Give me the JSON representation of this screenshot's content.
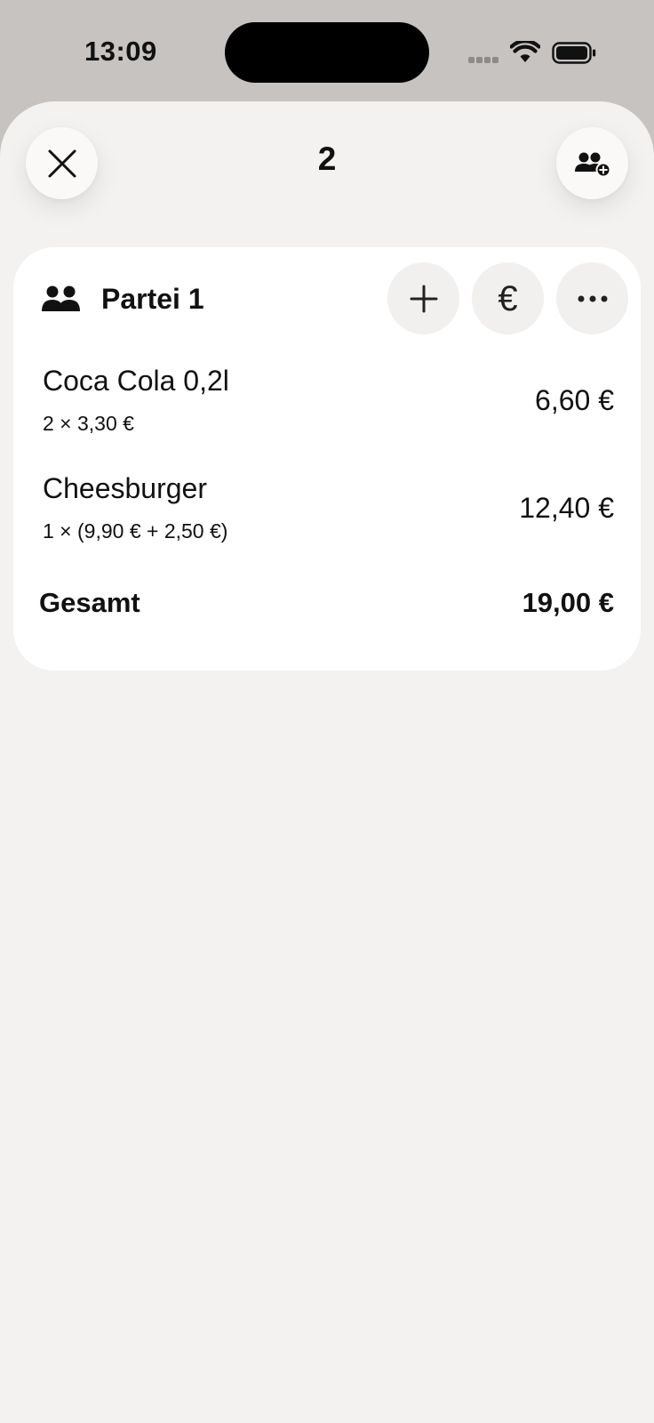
{
  "status_bar": {
    "time": "13:09"
  },
  "header": {
    "title": "2",
    "close_icon": "close-icon",
    "add_party_icon": "group-add-icon"
  },
  "party": {
    "name": "Partei 1",
    "icon": "group-icon",
    "actions": {
      "add_icon": "plus-icon",
      "pay_symbol": "€",
      "more_icon": "ellipsis-icon"
    },
    "items": [
      {
        "name": "Coca Cola 0,2l",
        "detail": "2 × 3,30 €",
        "price": "6,60 €"
      },
      {
        "name": "Cheesburger",
        "detail": "1 × (9,90 € + 2,50 €)",
        "price": "12,40 €"
      }
    ],
    "total_label": "Gesamt",
    "total_value": "19,00 €"
  },
  "colors": {
    "status_background": "#c7c3c1",
    "sheet_background": "#f3f2f0",
    "card_background": "#ffffff",
    "button_background": "#faf9f7"
  }
}
